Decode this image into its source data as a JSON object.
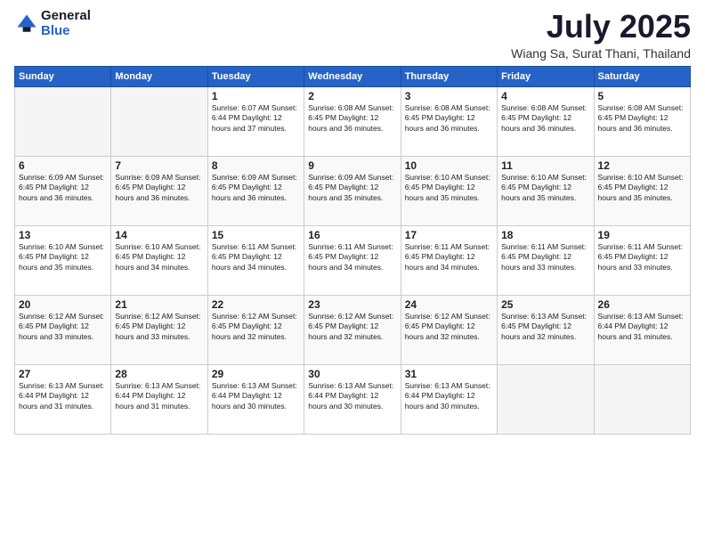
{
  "logo": {
    "general": "General",
    "blue": "Blue"
  },
  "title": "July 2025",
  "location": "Wiang Sa, Surat Thani, Thailand",
  "days_of_week": [
    "Sunday",
    "Monday",
    "Tuesday",
    "Wednesday",
    "Thursday",
    "Friday",
    "Saturday"
  ],
  "weeks": [
    [
      {
        "day": "",
        "info": ""
      },
      {
        "day": "",
        "info": ""
      },
      {
        "day": "1",
        "info": "Sunrise: 6:07 AM\nSunset: 6:44 PM\nDaylight: 12 hours and 37 minutes."
      },
      {
        "day": "2",
        "info": "Sunrise: 6:08 AM\nSunset: 6:45 PM\nDaylight: 12 hours and 36 minutes."
      },
      {
        "day": "3",
        "info": "Sunrise: 6:08 AM\nSunset: 6:45 PM\nDaylight: 12 hours and 36 minutes."
      },
      {
        "day": "4",
        "info": "Sunrise: 6:08 AM\nSunset: 6:45 PM\nDaylight: 12 hours and 36 minutes."
      },
      {
        "day": "5",
        "info": "Sunrise: 6:08 AM\nSunset: 6:45 PM\nDaylight: 12 hours and 36 minutes."
      }
    ],
    [
      {
        "day": "6",
        "info": "Sunrise: 6:09 AM\nSunset: 6:45 PM\nDaylight: 12 hours and 36 minutes."
      },
      {
        "day": "7",
        "info": "Sunrise: 6:09 AM\nSunset: 6:45 PM\nDaylight: 12 hours and 36 minutes."
      },
      {
        "day": "8",
        "info": "Sunrise: 6:09 AM\nSunset: 6:45 PM\nDaylight: 12 hours and 36 minutes."
      },
      {
        "day": "9",
        "info": "Sunrise: 6:09 AM\nSunset: 6:45 PM\nDaylight: 12 hours and 35 minutes."
      },
      {
        "day": "10",
        "info": "Sunrise: 6:10 AM\nSunset: 6:45 PM\nDaylight: 12 hours and 35 minutes."
      },
      {
        "day": "11",
        "info": "Sunrise: 6:10 AM\nSunset: 6:45 PM\nDaylight: 12 hours and 35 minutes."
      },
      {
        "day": "12",
        "info": "Sunrise: 6:10 AM\nSunset: 6:45 PM\nDaylight: 12 hours and 35 minutes."
      }
    ],
    [
      {
        "day": "13",
        "info": "Sunrise: 6:10 AM\nSunset: 6:45 PM\nDaylight: 12 hours and 35 minutes."
      },
      {
        "day": "14",
        "info": "Sunrise: 6:10 AM\nSunset: 6:45 PM\nDaylight: 12 hours and 34 minutes."
      },
      {
        "day": "15",
        "info": "Sunrise: 6:11 AM\nSunset: 6:45 PM\nDaylight: 12 hours and 34 minutes."
      },
      {
        "day": "16",
        "info": "Sunrise: 6:11 AM\nSunset: 6:45 PM\nDaylight: 12 hours and 34 minutes."
      },
      {
        "day": "17",
        "info": "Sunrise: 6:11 AM\nSunset: 6:45 PM\nDaylight: 12 hours and 34 minutes."
      },
      {
        "day": "18",
        "info": "Sunrise: 6:11 AM\nSunset: 6:45 PM\nDaylight: 12 hours and 33 minutes."
      },
      {
        "day": "19",
        "info": "Sunrise: 6:11 AM\nSunset: 6:45 PM\nDaylight: 12 hours and 33 minutes."
      }
    ],
    [
      {
        "day": "20",
        "info": "Sunrise: 6:12 AM\nSunset: 6:45 PM\nDaylight: 12 hours and 33 minutes."
      },
      {
        "day": "21",
        "info": "Sunrise: 6:12 AM\nSunset: 6:45 PM\nDaylight: 12 hours and 33 minutes."
      },
      {
        "day": "22",
        "info": "Sunrise: 6:12 AM\nSunset: 6:45 PM\nDaylight: 12 hours and 32 minutes."
      },
      {
        "day": "23",
        "info": "Sunrise: 6:12 AM\nSunset: 6:45 PM\nDaylight: 12 hours and 32 minutes."
      },
      {
        "day": "24",
        "info": "Sunrise: 6:12 AM\nSunset: 6:45 PM\nDaylight: 12 hours and 32 minutes."
      },
      {
        "day": "25",
        "info": "Sunrise: 6:13 AM\nSunset: 6:45 PM\nDaylight: 12 hours and 32 minutes."
      },
      {
        "day": "26",
        "info": "Sunrise: 6:13 AM\nSunset: 6:44 PM\nDaylight: 12 hours and 31 minutes."
      }
    ],
    [
      {
        "day": "27",
        "info": "Sunrise: 6:13 AM\nSunset: 6:44 PM\nDaylight: 12 hours and 31 minutes."
      },
      {
        "day": "28",
        "info": "Sunrise: 6:13 AM\nSunset: 6:44 PM\nDaylight: 12 hours and 31 minutes."
      },
      {
        "day": "29",
        "info": "Sunrise: 6:13 AM\nSunset: 6:44 PM\nDaylight: 12 hours and 30 minutes."
      },
      {
        "day": "30",
        "info": "Sunrise: 6:13 AM\nSunset: 6:44 PM\nDaylight: 12 hours and 30 minutes."
      },
      {
        "day": "31",
        "info": "Sunrise: 6:13 AM\nSunset: 6:44 PM\nDaylight: 12 hours and 30 minutes."
      },
      {
        "day": "",
        "info": ""
      },
      {
        "day": "",
        "info": ""
      }
    ]
  ]
}
